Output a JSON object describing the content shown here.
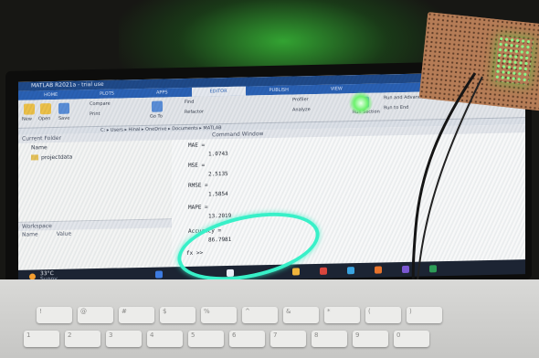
{
  "window": {
    "title": "MATLAB R2021a - trial use"
  },
  "tabs": [
    {
      "label": "HOME"
    },
    {
      "label": "PLOTS"
    },
    {
      "label": "APPS"
    },
    {
      "label": "EDITOR",
      "active": true
    },
    {
      "label": "PUBLISH"
    },
    {
      "label": "VIEW"
    }
  ],
  "ribbon": {
    "buttons": [
      {
        "label": "New"
      },
      {
        "label": "Open"
      },
      {
        "label": "Save"
      },
      {
        "label": "Compare"
      },
      {
        "label": "Print"
      },
      {
        "label": "Go To"
      },
      {
        "label": "Find"
      },
      {
        "label": "Refactor"
      },
      {
        "label": "Profiler"
      },
      {
        "label": "Analyze"
      },
      {
        "label": "Run Section"
      },
      {
        "label": "Run and Advance"
      },
      {
        "label": "Run to End"
      }
    ]
  },
  "address_bar": {
    "path": "C: ▸ Users ▸ Hinal ▸ OneDrive ▸ Documents ▸ MATLAB"
  },
  "current_folder": {
    "title": "Current Folder",
    "header": "Name",
    "items": [
      {
        "label": "projectdata"
      }
    ]
  },
  "workspace": {
    "title": "Workspace",
    "headers": [
      "Name",
      "Value"
    ]
  },
  "command_window": {
    "title": "Command Window",
    "lines": [
      {
        "text": "MAE ="
      },
      {
        "text": "1.0743"
      },
      {
        "text": "MSE ="
      },
      {
        "text": "2.5135"
      },
      {
        "text": "RMSE ="
      },
      {
        "text": "1.5854"
      },
      {
        "text": "MAPE ="
      },
      {
        "text": "13.2019"
      },
      {
        "text": "Accuracy ="
      },
      {
        "text": "86.7981"
      },
      {
        "text": "fx >>"
      }
    ]
  },
  "taskbar": {
    "temperature": "33°C",
    "condition": "Sunny"
  },
  "keyboard": {
    "rows": [
      [
        "!",
        "@",
        "#",
        "$",
        "%",
        "^",
        "&",
        "*",
        "(",
        ")"
      ],
      [
        "1",
        "2",
        "3",
        "4",
        "5",
        "6",
        "7",
        "8",
        "9",
        "0"
      ]
    ]
  },
  "colors": {
    "highlight_ring": "#38f0c8",
    "led_green": "#6cf26c",
    "matlab_blue": "#2a62b6",
    "perfboard": "#b57c56"
  }
}
